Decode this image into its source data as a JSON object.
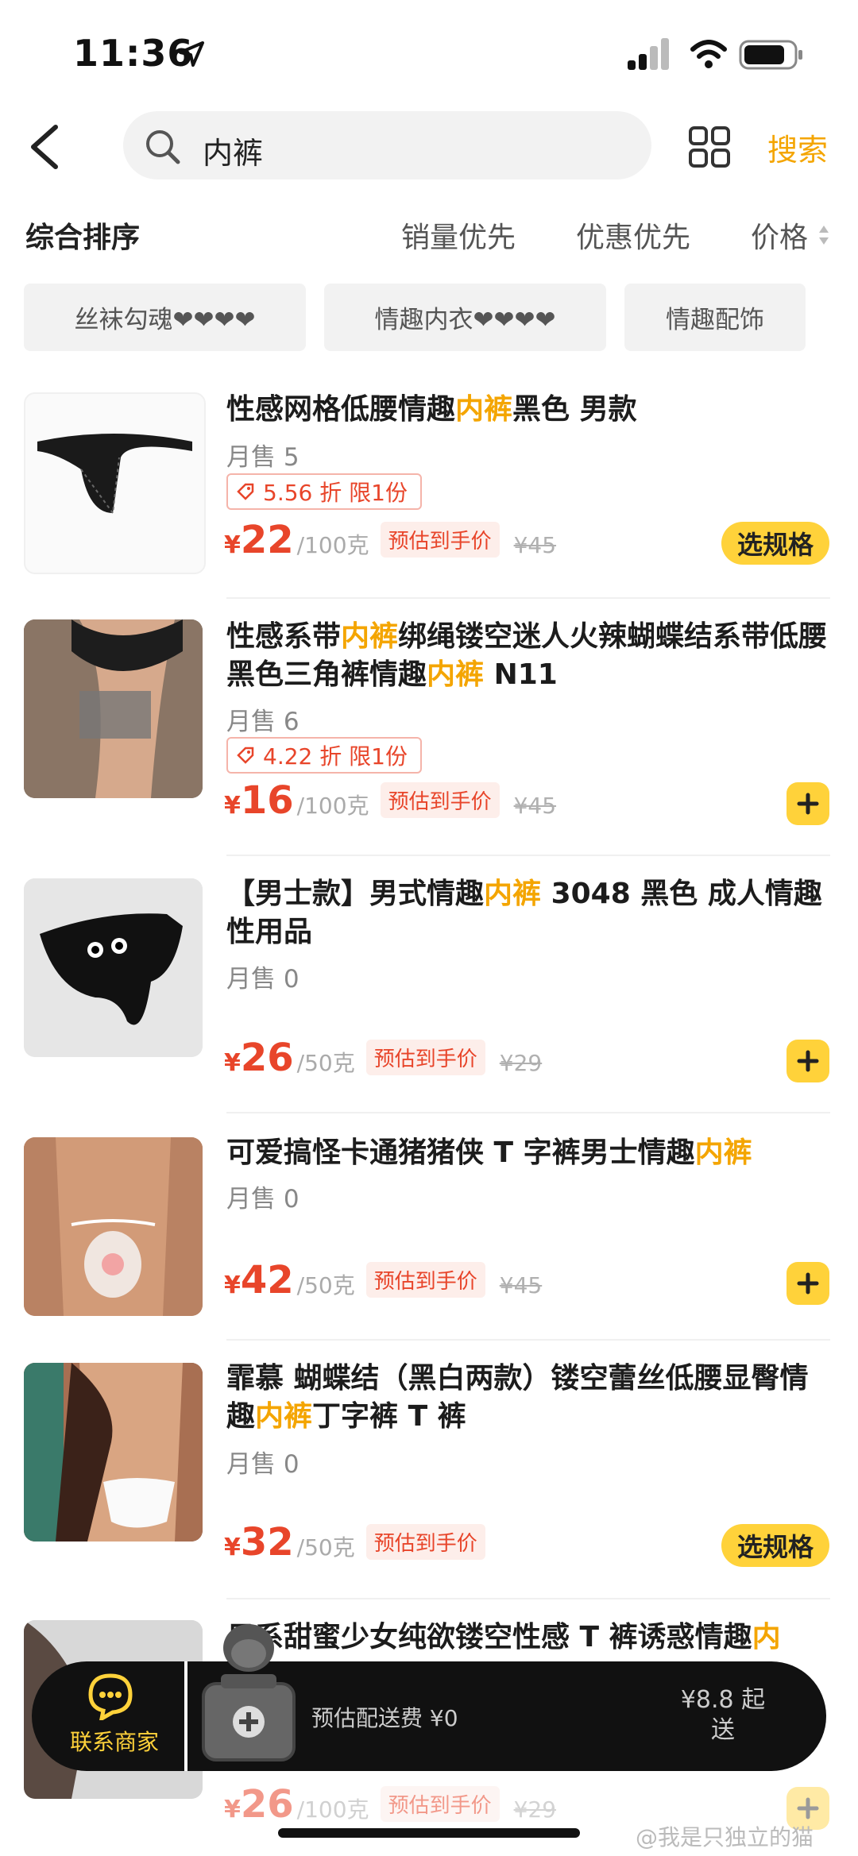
{
  "status_bar": {
    "time": "11:36"
  },
  "search": {
    "query": "内裤",
    "submit_label": "搜索"
  },
  "sort": {
    "options": [
      "综合排序",
      "销量优先",
      "优惠优先",
      "价格"
    ]
  },
  "chips": [
    "丝袜勾魂❤❤❤❤",
    "情趣内衣❤❤❤❤",
    "情趣配饰"
  ],
  "products": [
    {
      "title_parts": [
        "性感网格低腰情趣",
        "内裤",
        "黑色 男款"
      ],
      "sales": "月售 5",
      "promo": "5.56 折 限1份",
      "currency": "¥",
      "price": "22",
      "unit": "/100克",
      "estimate": "预估到手价",
      "original": "¥45",
      "action": "选规格"
    },
    {
      "title_parts": [
        "性感系带",
        "内裤",
        "绑绳镂空迷人火辣蝴蝶结系带低腰黑色三角裤情趣",
        "内裤",
        " N11"
      ],
      "sales": "月售 6",
      "promo": "4.22 折 限1份",
      "currency": "¥",
      "price": "16",
      "unit": "/100克",
      "estimate": "预估到手价",
      "original": "¥45",
      "action": "+"
    },
    {
      "title_parts": [
        "【男士款】男式情趣",
        "内裤",
        " 3048 黑色 成人情趣性用品"
      ],
      "sales": "月售 0",
      "currency": "¥",
      "price": "26",
      "unit": "/50克",
      "estimate": "预估到手价",
      "original": "¥29",
      "action": "+"
    },
    {
      "title_parts": [
        "可爱搞怪卡通猪猪侠 T 字裤男士情趣",
        "内裤"
      ],
      "sales": "月售 0",
      "currency": "¥",
      "price": "42",
      "unit": "/50克",
      "estimate": "预估到手价",
      "original": "¥45",
      "action": "+"
    },
    {
      "title_parts": [
        "霏慕 蝴蝶结（黑白两款）镂空蕾丝低腰显臀情趣",
        "内裤",
        "丁字裤 T 裤"
      ],
      "sales": "月售 0",
      "currency": "¥",
      "price": "32",
      "unit": "/50克",
      "estimate": "预估到手价",
      "action": "选规格"
    },
    {
      "title_parts": [
        "日系甜蜜少女纯欲镂空性感 T 裤诱惑情趣",
        "内"
      ],
      "currency": "¥",
      "price": "26",
      "unit": "/100克",
      "estimate": "预估到手价",
      "original": "¥29",
      "action": "+"
    }
  ],
  "bottom_bar": {
    "contact": "联系商家",
    "delivery_fee": "预估配送费 ¥0",
    "min_order_line1": "¥8.8 起",
    "min_order_line2": "送"
  },
  "watermark": "@我是只独立的猫",
  "colors": {
    "accent": "#f4a500",
    "price": "#e8452a",
    "button": "#ffd23a",
    "bar": "#111111"
  }
}
